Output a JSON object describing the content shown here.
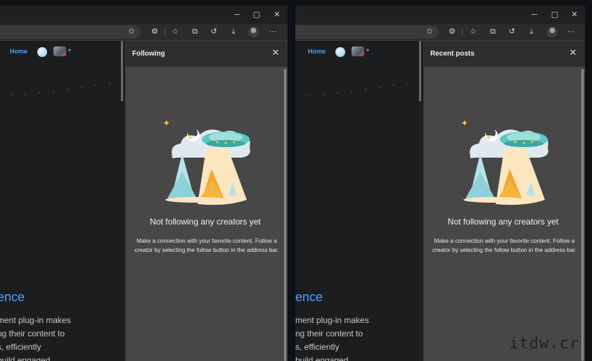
{
  "window_controls": {
    "minimize": "─",
    "maximize": "▢",
    "close": "✕"
  },
  "toolbar_icons": [
    "favorite-add-icon",
    "extensions-icon",
    "favorites-icon",
    "collections-icon",
    "history-icon",
    "downloads-icon",
    "profile-avatar",
    "more-icon"
  ],
  "toolbar_glyphs": {
    "favorite": "✩",
    "extensions": "⚙",
    "favorites": "☆",
    "collections": "⧉",
    "history": "↺",
    "downloads": "⤓",
    "more": "···"
  },
  "page": {
    "nav_home": "Home",
    "caret": "▾",
    "heading": "ence",
    "lines": [
      "ment plug-in makes",
      "ng their content to",
      "s, efficiently",
      "build engaged"
    ]
  },
  "left_pane": {
    "title": "Following",
    "close": "✕",
    "empty_title": "Not following any creators yet",
    "empty_desc": "Make a connection with your favorite content. Follow a creator by selecting the follow button in the address bar."
  },
  "right_pane": {
    "title": "Recent posts",
    "close": "✕",
    "empty_title": "Not following any creators yet",
    "empty_desc": "Make a connection with your favorite content. Follow a creator by selecting the follow button in the address bar."
  },
  "watermark": "itdw.cr",
  "colors": {
    "accent": "#4aa3ff",
    "pane_bg": "#474747",
    "header_bg": "#2e2e2e"
  }
}
